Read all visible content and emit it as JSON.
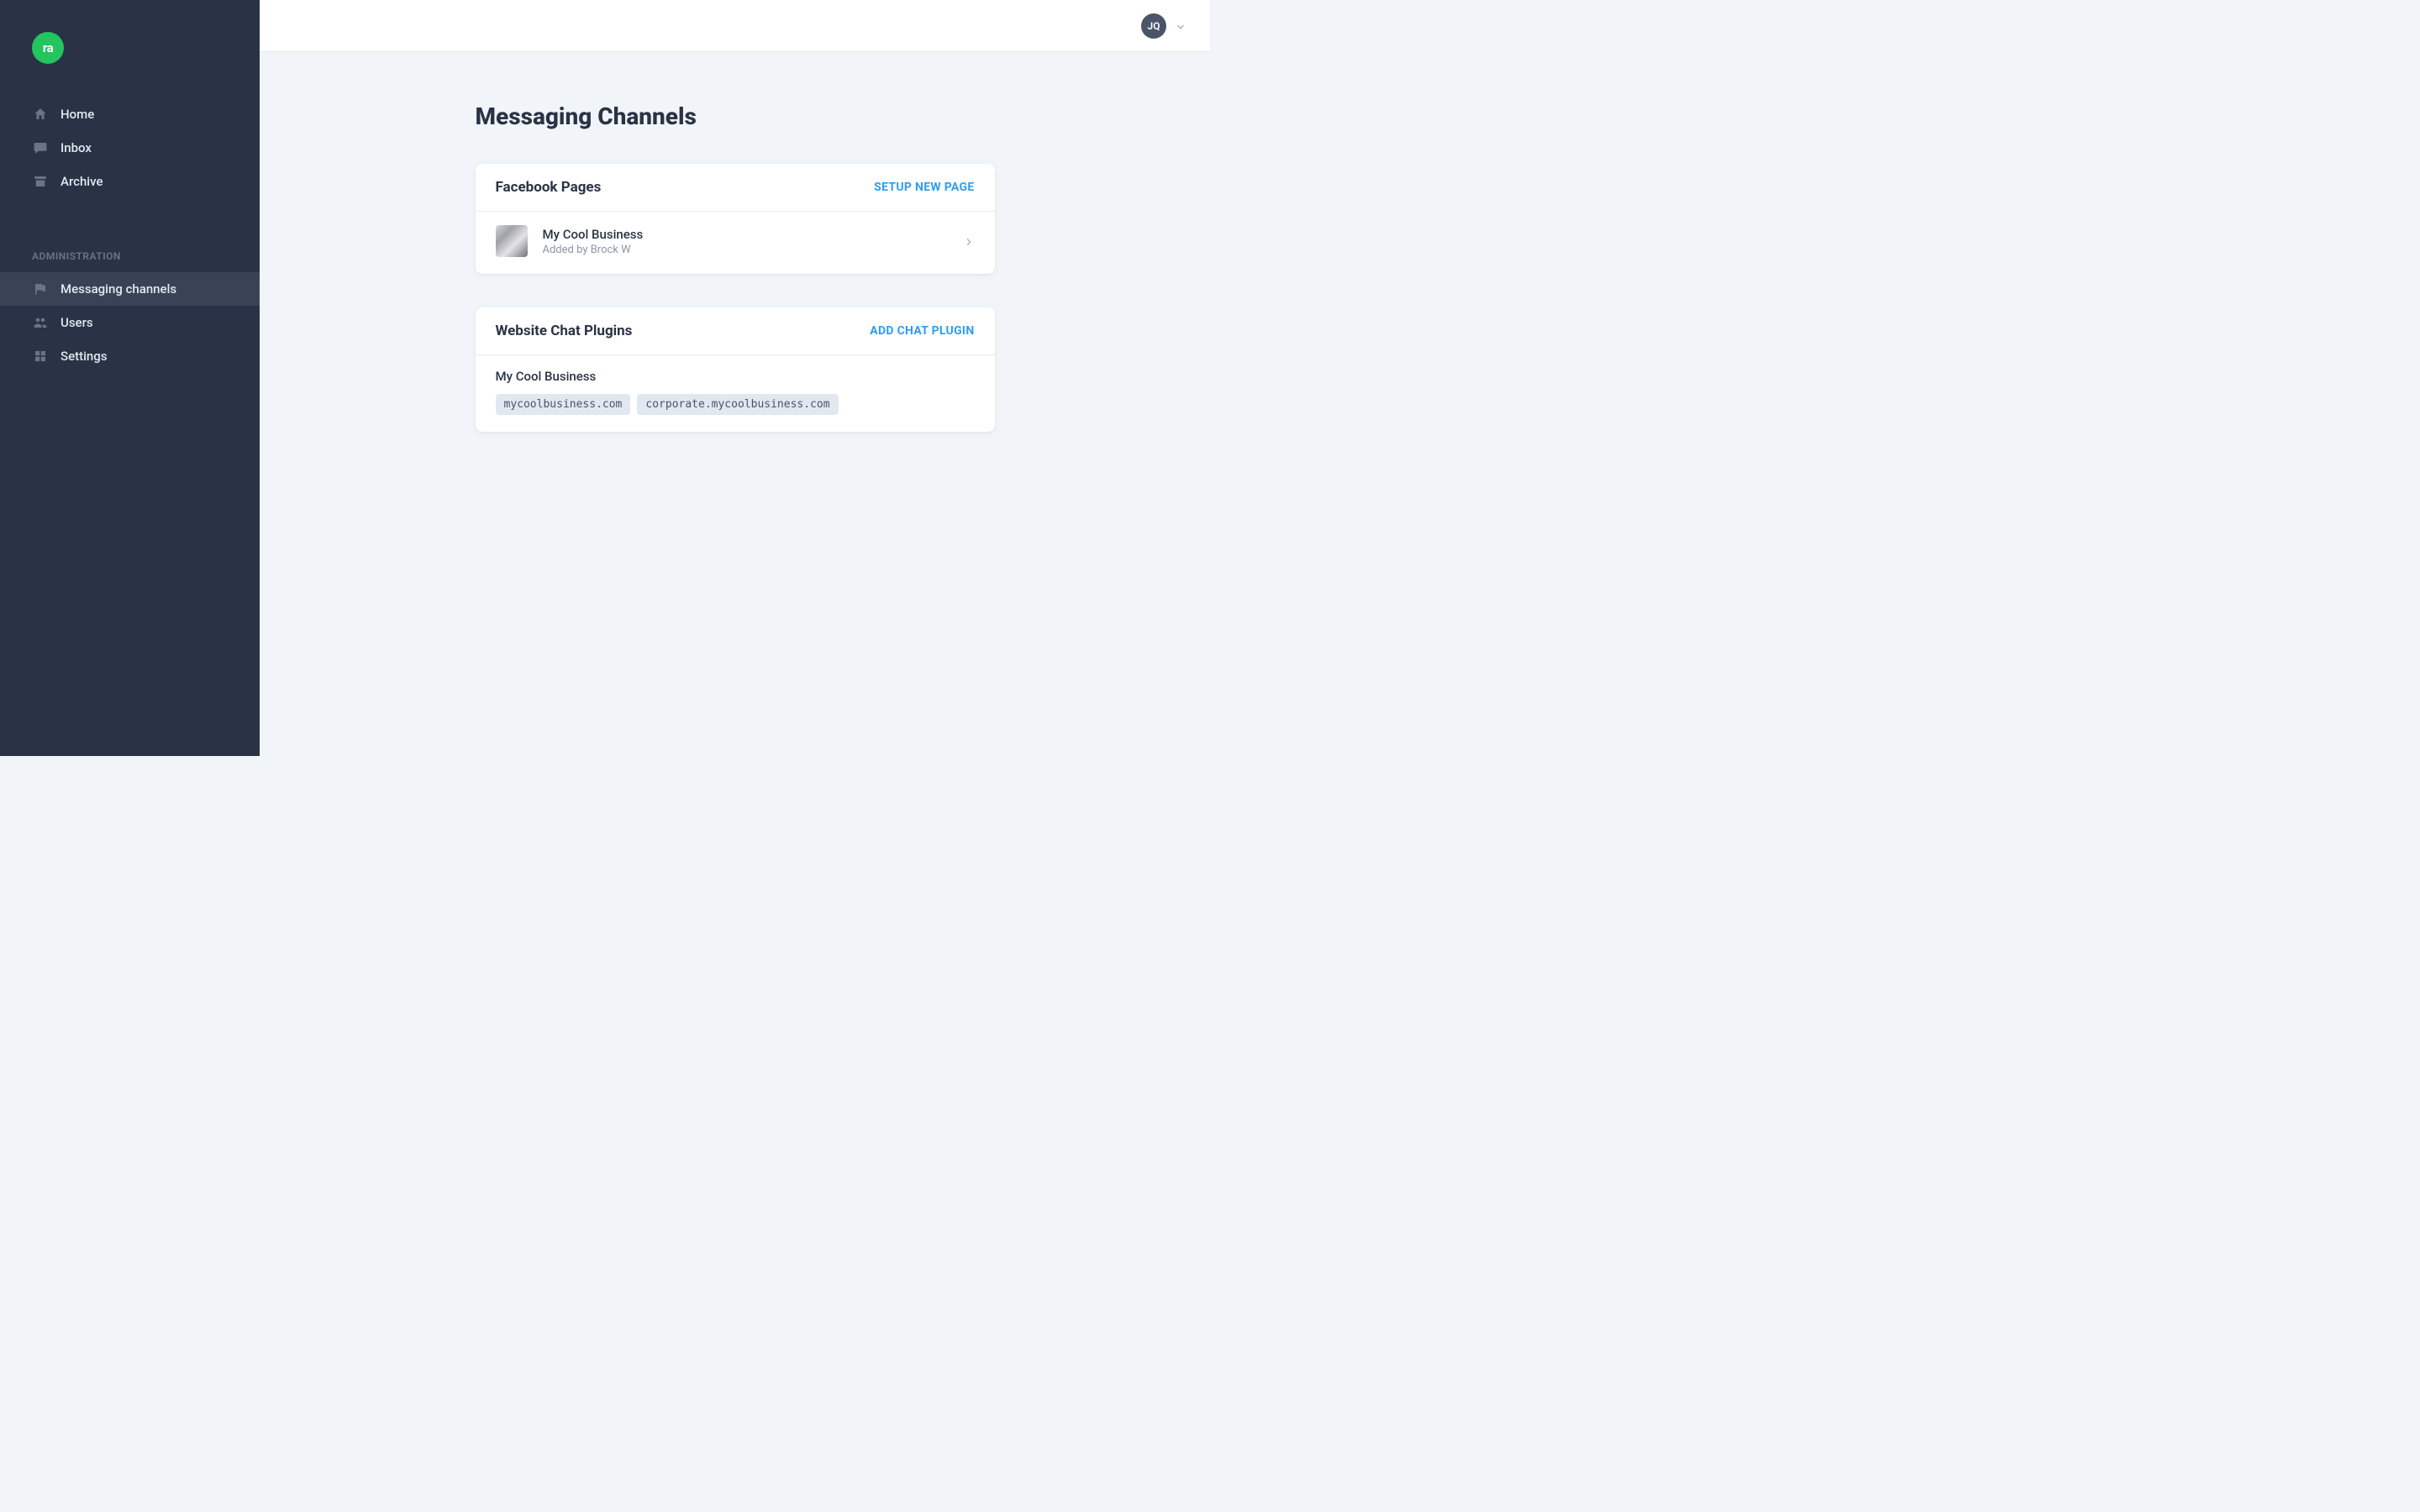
{
  "brand": {
    "logo_text": "ra"
  },
  "sidebar": {
    "primary": [
      {
        "label": "Home",
        "icon": "home-icon"
      },
      {
        "label": "Inbox",
        "icon": "chat-icon"
      },
      {
        "label": "Archive",
        "icon": "archive-icon"
      }
    ],
    "admin_title": "ADMINISTRATION",
    "admin": [
      {
        "label": "Messaging channels",
        "icon": "flag-icon",
        "active": true
      },
      {
        "label": "Users",
        "icon": "users-icon"
      },
      {
        "label": "Settings",
        "icon": "settings-icon"
      }
    ]
  },
  "header": {
    "user_initials": "JQ"
  },
  "main": {
    "title": "Messaging Channels",
    "facebook": {
      "section_title": "Facebook Pages",
      "action_label": "SETUP NEW PAGE",
      "pages": [
        {
          "name": "My Cool Business",
          "added_by": "Added by Brock W"
        }
      ]
    },
    "chat_plugins": {
      "section_title": "Website Chat Plugins",
      "action_label": "ADD CHAT PLUGIN",
      "plugins": [
        {
          "name": "My Cool Business",
          "domains": [
            "mycoolbusiness.com",
            "corporate.mycoolbusiness.com"
          ]
        }
      ]
    }
  }
}
